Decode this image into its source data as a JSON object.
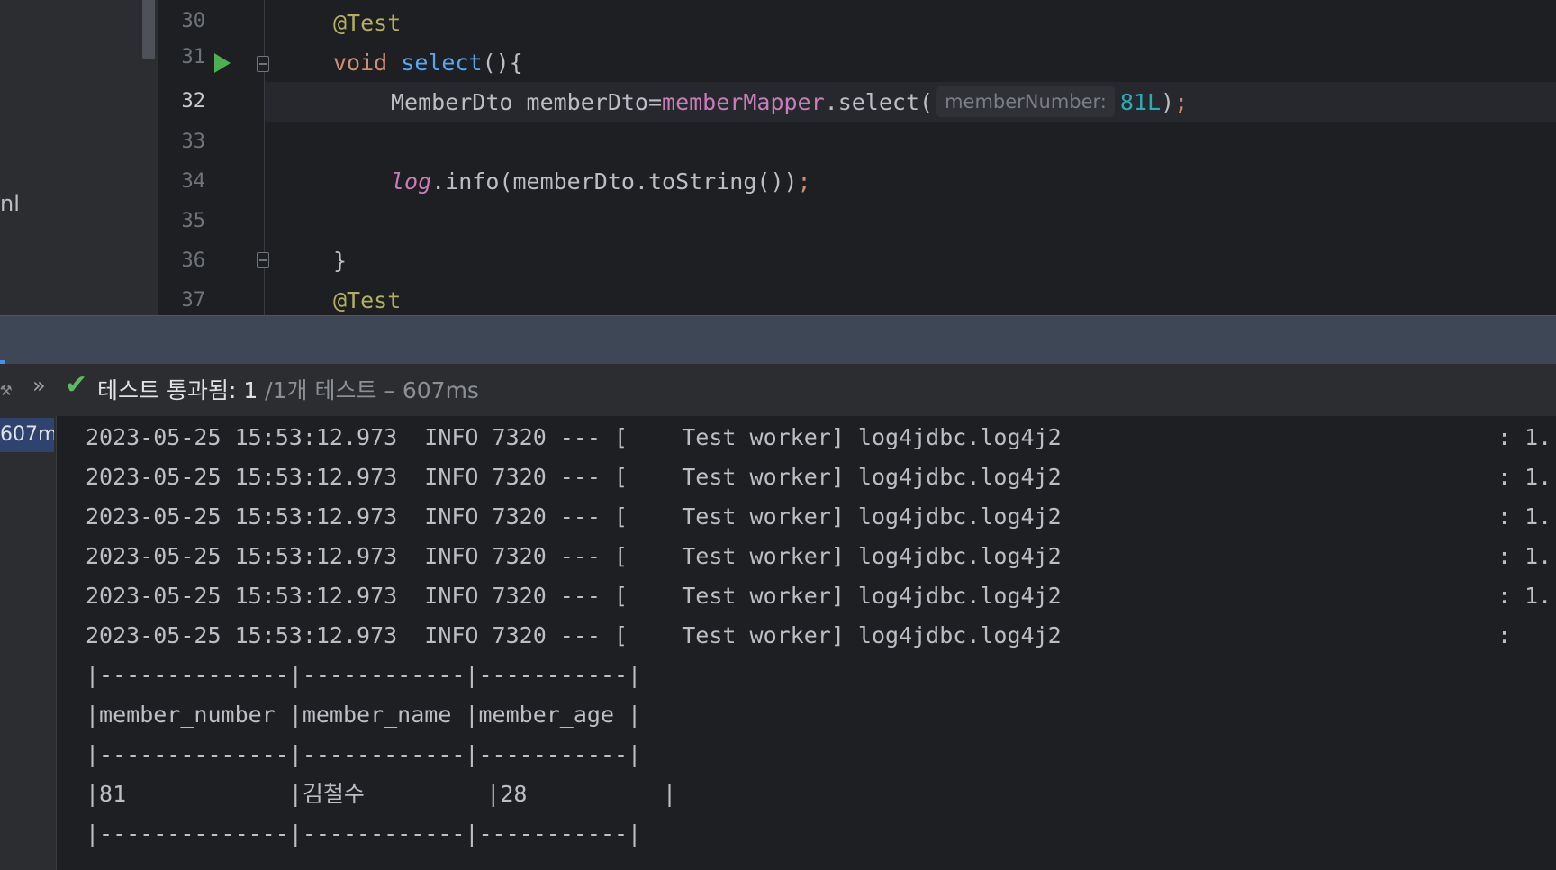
{
  "editor": {
    "project_fragment": "nl",
    "current_line": "32",
    "line_numbers": [
      "30",
      "31",
      "32",
      "33",
      "34",
      "35",
      "36",
      "37"
    ],
    "code": {
      "l30_annotation": "@Test",
      "l31_keyword": "void",
      "l31_method": "select",
      "l31_rest": "(){",
      "l32_type_var": "MemberDto memberDto=",
      "l32_field": "memberMapper",
      "l32_call": ".select(",
      "l32_hint": "memberNumber:",
      "l32_arg": "81L",
      "l32_close": ")",
      "l32_semi": ";",
      "l34_log": "log",
      "l34_call": ".info(memberDto.toString())",
      "l34_semi": ";",
      "l36_brace": "}",
      "l37_annotation": "@Test"
    }
  },
  "test_status": {
    "expand_icon": "»",
    "pass_icon": "✔",
    "passed_label": "테스트 통과됨: 1",
    "total_label": " /1개 테스트 – 607ms",
    "tree_duration": "607ms"
  },
  "console": {
    "log_lines": [
      {
        "text": "2023-05-25 15:53:12.973  INFO 7320 --- [    Test worker] log4jdbc.log4j2",
        "trail": ": 1."
      },
      {
        "text": "2023-05-25 15:53:12.973  INFO 7320 --- [    Test worker] log4jdbc.log4j2",
        "trail": ": 1."
      },
      {
        "text": "2023-05-25 15:53:12.973  INFO 7320 --- [    Test worker] log4jdbc.log4j2",
        "trail": ": 1."
      },
      {
        "text": "2023-05-25 15:53:12.973  INFO 7320 --- [    Test worker] log4jdbc.log4j2",
        "trail": ": 1."
      },
      {
        "text": "2023-05-25 15:53:12.973  INFO 7320 --- [    Test worker] log4jdbc.log4j2",
        "trail": ": 1."
      },
      {
        "text": "2023-05-25 15:53:12.973  INFO 7320 --- [    Test worker] log4jdbc.log4j2",
        "trail": ":"
      }
    ],
    "result_table": {
      "border": "|--------------|------------|-----------|",
      "header": "|member_number |member_name |member_age |",
      "row": "|81            |김철수         |28          |"
    }
  },
  "colors": {
    "background": "#1e1f22",
    "annotation": "#b3ae60",
    "keyword": "#cf8e6d",
    "method": "#56a8f5",
    "field": "#c77dbb",
    "number": "#2aacb8",
    "pass_green": "#5fb865",
    "header_bar": "#3d4756"
  }
}
